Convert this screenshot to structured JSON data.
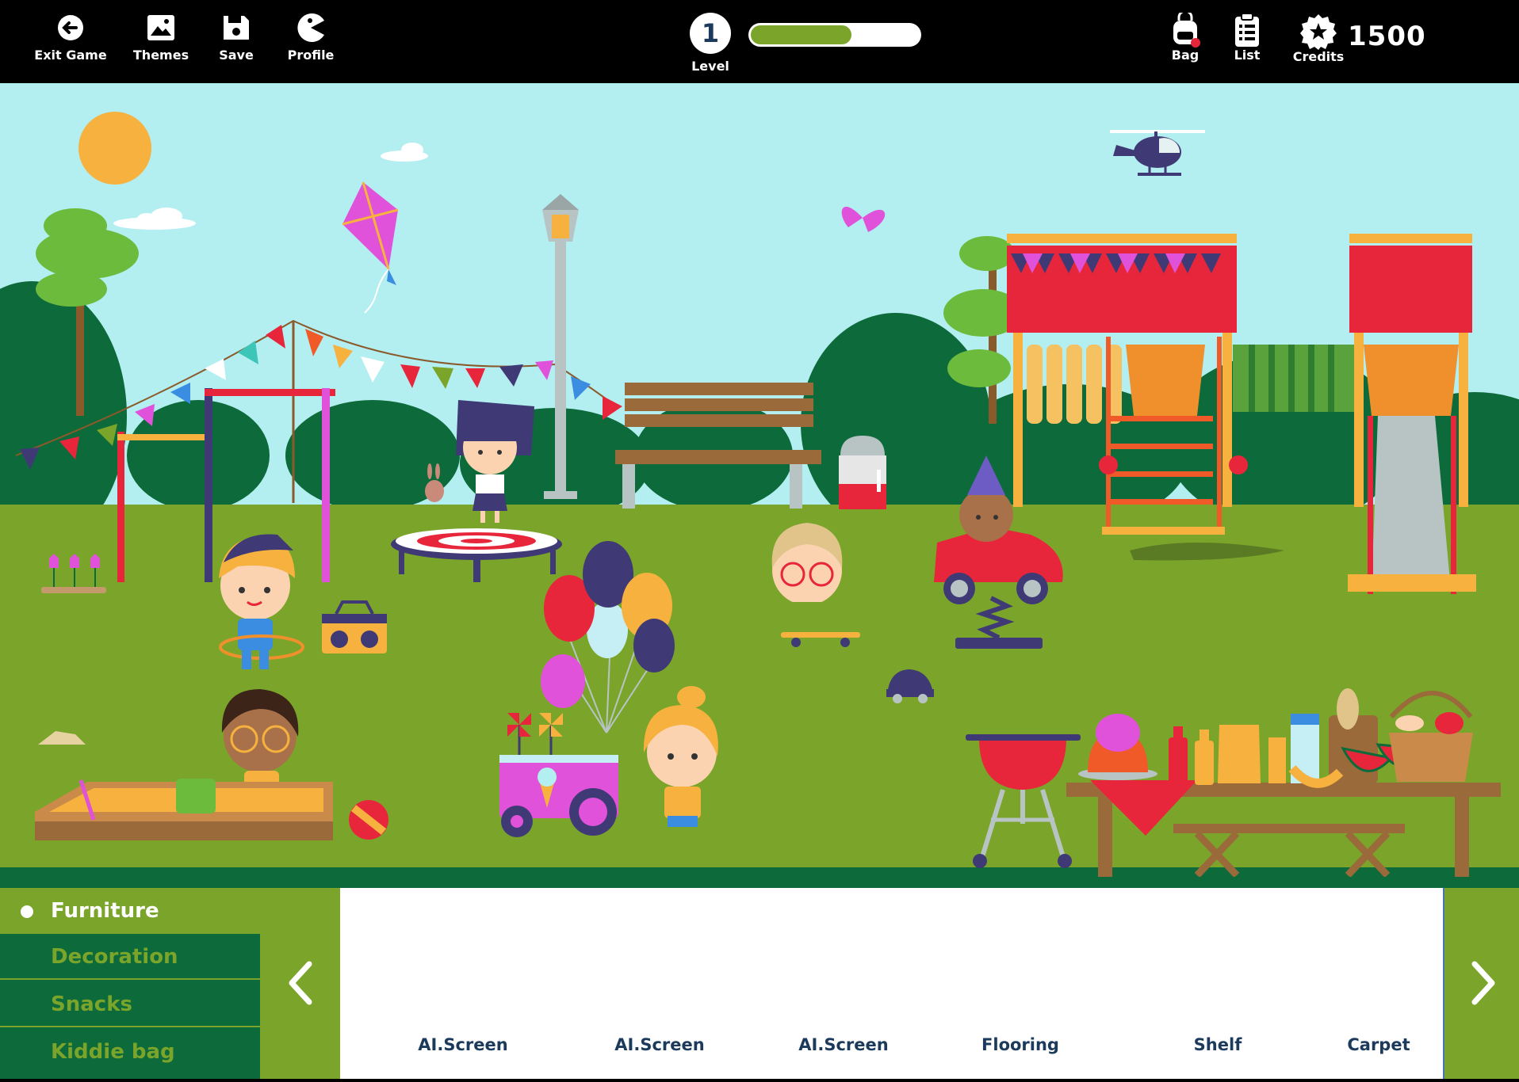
{
  "toolbar": {
    "exit_label": "Exit Game",
    "themes_label": "Themes",
    "save_label": "Save",
    "profile_label": "Profile",
    "level_number": "1",
    "level_label": "Level",
    "level_progress": 0.6,
    "bag_label": "Bag",
    "list_label": "List",
    "credits_label": "Credits",
    "credits_value": "1500"
  },
  "icons": {
    "exit": "exit-icon",
    "themes": "image-icon",
    "save": "floppy-icon",
    "profile": "pacman-icon",
    "bag": "backpack-icon",
    "list": "clipboard-icon",
    "credits": "star-badge-icon"
  },
  "categories": [
    {
      "label": "Furniture",
      "active": true
    },
    {
      "label": "Decoration",
      "active": false
    },
    {
      "label": "Snacks",
      "active": false
    },
    {
      "label": "Kiddie bag",
      "active": false
    }
  ],
  "items": [
    {
      "label": "AI.Screen"
    },
    {
      "label": "AI.Screen"
    },
    {
      "label": "AI.Screen"
    },
    {
      "label": "Flooring"
    },
    {
      "label": "Shelf"
    },
    {
      "label": "Carpet"
    }
  ],
  "colors": {
    "sky": "#b3eef0",
    "grass": "#7aa52a",
    "dark_green": "#0d6a3a",
    "accent_red": "#e8263b",
    "text_navy": "#1b3a5c"
  }
}
